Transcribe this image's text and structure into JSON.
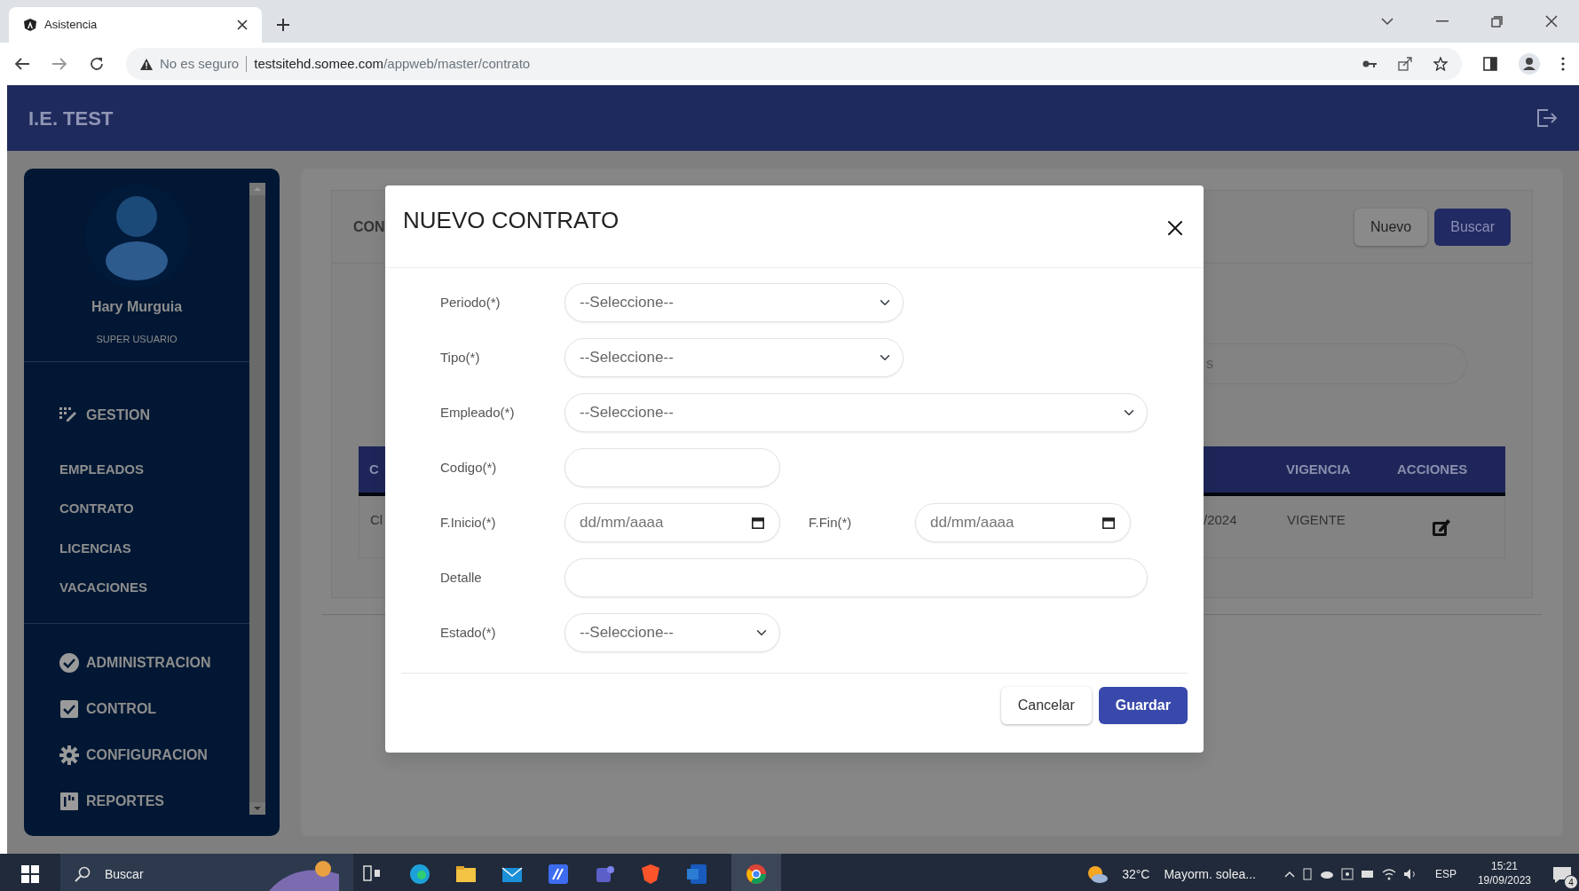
{
  "browser": {
    "tab_title": "Asistencia",
    "security": "No es seguro",
    "url_host": "testsitehd.somee.com",
    "url_path": "/appweb/master/contrato"
  },
  "header": {
    "title": "I.E. TEST"
  },
  "sidebar": {
    "user_name": "Hary Murguia",
    "role": "SUPER USUARIO",
    "sections": [
      {
        "label": "GESTION",
        "items": [
          "EMPLEADOS",
          "CONTRATO",
          "LICENCIAS",
          "VACACIONES"
        ]
      },
      {
        "label": "ADMINISTRACION"
      },
      {
        "label": "CONTROL"
      },
      {
        "label": "CONFIGURACION"
      },
      {
        "label": "REPORTES"
      }
    ]
  },
  "page": {
    "title": "CON",
    "buttons": [
      {
        "label": "Nuevo",
        "kind": "secondary"
      },
      {
        "label": "Buscar",
        "kind": "primary"
      }
    ],
    "search_fragment": "s",
    "table": {
      "columns": [
        "C",
        "",
        "VIGENCIA",
        "ACCIONES"
      ],
      "rows": [
        {
          "cells": [
            "Cl",
            "/2024",
            "VIGENTE"
          ]
        }
      ]
    }
  },
  "modal": {
    "title": "NUEVO CONTRATO",
    "rows": [
      {
        "fields": [
          {
            "label": "Periodo(*)",
            "kind": "select",
            "value": "--Seleccione--"
          }
        ]
      },
      {
        "fields": [
          {
            "label": "Tipo(*)",
            "kind": "select",
            "value": "--Seleccione--"
          }
        ]
      },
      {
        "fields": [
          {
            "label": "Empleado(*)",
            "kind": "select",
            "value": "--Seleccione--"
          }
        ]
      },
      {
        "fields": [
          {
            "label": "Codigo(*)",
            "kind": "text"
          }
        ]
      },
      {
        "fields": [
          {
            "label": "F.Inicio(*)",
            "kind": "date",
            "placeholder": "dd/mm/aaaa"
          },
          {
            "label": "F.Fin(*)",
            "kind": "date",
            "placeholder": "dd/mm/aaaa"
          }
        ]
      },
      {
        "fields": [
          {
            "label": "Detalle",
            "kind": "text"
          }
        ]
      },
      {
        "fields": [
          {
            "label": "Estado(*)",
            "kind": "select",
            "value": "--Seleccione--"
          }
        ]
      }
    ],
    "buttons": [
      {
        "label": "Cancelar",
        "kind": "secondary"
      },
      {
        "label": "Guardar",
        "kind": "primary"
      }
    ]
  },
  "taskbar": {
    "search": "Buscar",
    "weather": "32°C",
    "weather_text": "Mayorm. solea...",
    "language": "ESP",
    "time": "15:21",
    "date": "19/09/2023",
    "notifications": "4"
  }
}
